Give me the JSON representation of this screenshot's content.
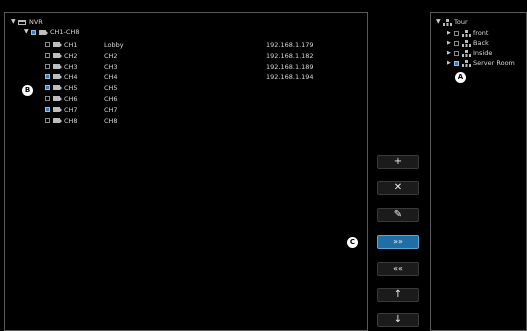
{
  "device_tree": {
    "root_label": "NVR",
    "group_label": "CH1-CH8",
    "channels": [
      {
        "name": "CH1",
        "alias": "Lobby",
        "ip": "192.168.1.179",
        "checked": false
      },
      {
        "name": "CH2",
        "alias": "CH2",
        "ip": "192.168.1.182",
        "checked": false
      },
      {
        "name": "CH3",
        "alias": "CH3",
        "ip": "192.168.1.189",
        "checked": false
      },
      {
        "name": "CH4",
        "alias": "CH4",
        "ip": "192.168.1.194",
        "checked": true
      },
      {
        "name": "CH5",
        "alias": "CH5",
        "ip": "",
        "checked": true
      },
      {
        "name": "CH6",
        "alias": "CH6",
        "ip": "",
        "checked": false
      },
      {
        "name": "CH7",
        "alias": "CH7",
        "ip": "",
        "checked": true
      },
      {
        "name": "CH8",
        "alias": "CH8",
        "ip": "",
        "checked": false
      }
    ]
  },
  "tour_tree": {
    "root_label": "Tour",
    "items": [
      {
        "label": "front",
        "checked": false
      },
      {
        "label": "Back",
        "checked": false
      },
      {
        "label": "Inside",
        "checked": false
      },
      {
        "label": "Server Room",
        "checked": true
      }
    ]
  },
  "buttons": {
    "add": "+",
    "delete": "✕",
    "edit": "✎",
    "move_right": "»»",
    "move_left": "««",
    "up": "↑",
    "down": "↓"
  },
  "callouts": {
    "a": "A",
    "b": "B",
    "c": "C"
  }
}
